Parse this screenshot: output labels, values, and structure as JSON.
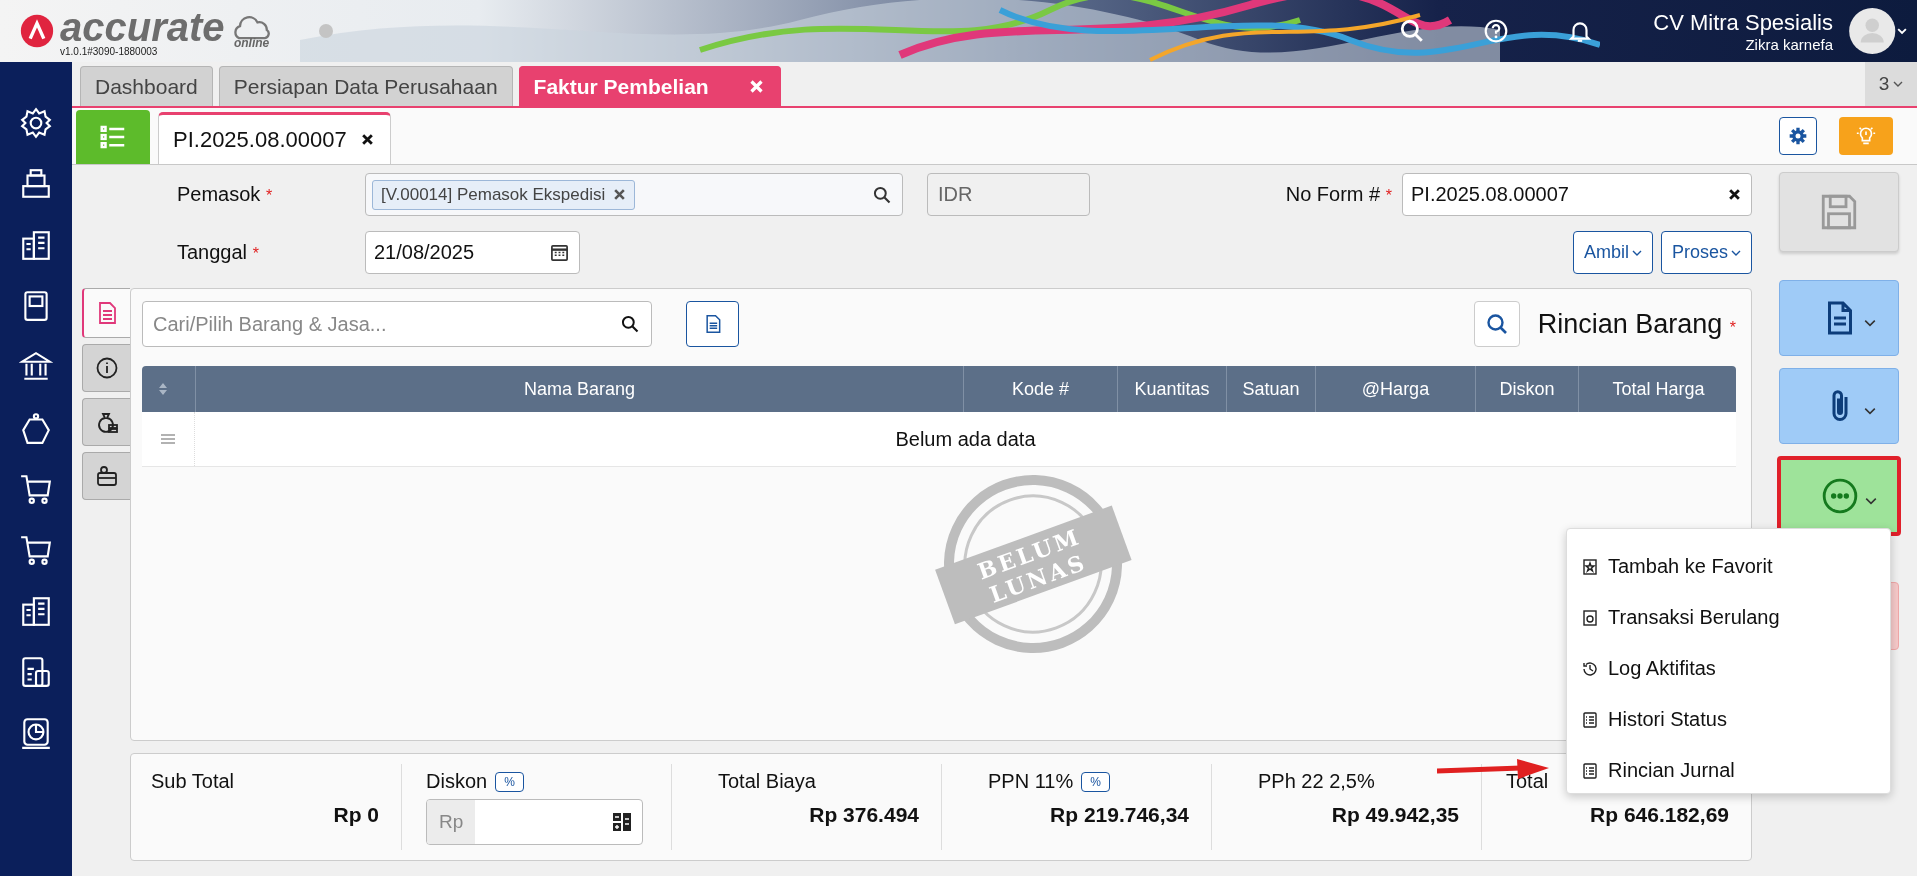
{
  "app": {
    "logo": "accurate",
    "logo_sub": "online",
    "version": "v1.0.1#3090-1880003"
  },
  "header": {
    "company": "CV Mitra Spesialis",
    "user": "Zikra karnefa"
  },
  "tabs": [
    {
      "label": "Dashboard",
      "selected": false,
      "closable": false
    },
    {
      "label": "Persiapan Data Perusahaan",
      "selected": false,
      "closable": false
    },
    {
      "label": "Faktur Pembelian",
      "selected": true,
      "closable": true
    }
  ],
  "tab_count": "3",
  "document_tabs": [
    {
      "label": "PI.2025.08.00007",
      "selected": true,
      "closable": true
    }
  ],
  "form": {
    "supplier": {
      "label": "Pemasok",
      "mark": "*",
      "tag": "[V.00014] Pemasok Ekspedisi"
    },
    "currency": {
      "value": "IDR"
    },
    "form_no": {
      "label": "No Form #",
      "mark": "*",
      "value": "PI.2025.08.00007"
    },
    "date": {
      "label": "Tanggal",
      "mark": "*",
      "value": "21/08/2025"
    },
    "buttons": [
      "Ambil",
      "Proses"
    ]
  },
  "side_tabs": [
    {
      "kind": "document",
      "selected": true
    },
    {
      "kind": "info",
      "selected": false
    },
    {
      "kind": "money",
      "selected": false
    },
    {
      "kind": "card",
      "selected": false
    }
  ],
  "items": {
    "search_placeholder": "Cari/Pilih Barang & Jasa...",
    "title": "Rincian Barang",
    "title_mark": "*",
    "columns": [
      "Nama Barang",
      "Kode #",
      "Kuantitas",
      "Satuan",
      "@Harga",
      "Diskon",
      "Total Harga"
    ],
    "empty": "Belum ada data",
    "stamp": [
      "BELUM",
      "LUNAS"
    ]
  },
  "totals": [
    {
      "kind": "value",
      "label": "Sub Total",
      "value": "Rp 0"
    },
    {
      "kind": "input",
      "label": "Diskon",
      "badge": "%",
      "prefix": "Rp"
    },
    {
      "kind": "value",
      "label": "Total Biaya",
      "value": "Rp 376.494"
    },
    {
      "kind": "value",
      "label": "PPN 11%",
      "badge": "%",
      "value": "Rp 219.746,34"
    },
    {
      "kind": "value",
      "label": "PPh 22 2,5%",
      "value": "Rp 49.942,35"
    },
    {
      "kind": "value",
      "label": "Total",
      "value": "Rp 646.182,69"
    }
  ],
  "actions": [
    {
      "kind": "save",
      "disabled": true,
      "highlighted": false
    },
    {
      "kind": "document",
      "disabled": false,
      "highlighted": false
    },
    {
      "kind": "attach",
      "disabled": false,
      "highlighted": false
    },
    {
      "kind": "more",
      "disabled": false,
      "highlighted": true
    },
    {
      "kind": "delete",
      "disabled": false,
      "highlighted": false
    }
  ],
  "menu": [
    {
      "kind": "favorite",
      "label": "Tambah ke Favorit",
      "pointed": false
    },
    {
      "kind": "repeat",
      "label": "Transaksi Berulang",
      "pointed": false
    },
    {
      "kind": "history",
      "label": "Log Aktifitas",
      "pointed": false
    },
    {
      "kind": "status",
      "label": "Histori Status",
      "pointed": false
    },
    {
      "kind": "journal",
      "label": "Rincian Jurnal",
      "pointed": true
    }
  ]
}
